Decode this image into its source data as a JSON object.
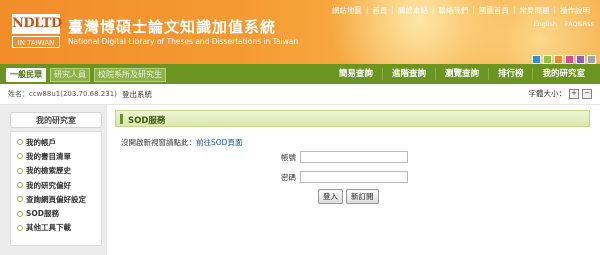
{
  "header": {
    "logo_text": "NDLTD",
    "logo_sub": "IN TAIWAN",
    "title": "臺灣博碩士論文知識加值系統",
    "subtitle": "National Digital Library of Theses and Dissertations in Taiwan",
    "top_links": [
      "網站地圖",
      "首頁",
      "關於本站",
      "聯絡我們",
      "國圖首頁",
      "常見問題",
      "操作說明"
    ],
    "languages": [
      "English",
      "FAQ&Rss"
    ],
    "theme_colors": [
      "#2f8fd6",
      "#8dc63f",
      "#f28c28",
      "#d84b8e",
      "#9b59b6",
      "#9aa7b3"
    ]
  },
  "roles": [
    "一般民眾",
    "研究人員",
    "校院系所及研究生"
  ],
  "main_nav": [
    "簡易查詢",
    "進階查詢",
    "瀏覽查詢",
    "排行榜",
    "我的研究室"
  ],
  "info": {
    "user": "姓名：ccw88u1(203.70.68.231)",
    "logout": "登出系統",
    "font_size_label": "字體大小：",
    "font_plus": "+",
    "font_minus": "−"
  },
  "sidebar": {
    "title": "我的研究室",
    "items": [
      "我的帳戶",
      "我的書目清單",
      "我的檢索歷史",
      "我的研究偏好",
      "查詢網頁偏好設定",
      "SOD服務",
      "其他工具下載"
    ]
  },
  "page": {
    "title": "SOD服務",
    "notice": "沒開啟新視窗請點此：",
    "notice_link": "前往SOD頁面",
    "account_label": "帳號",
    "account_value": "",
    "password_label": "密碼",
    "password_value": "",
    "login_button": "登入",
    "register_button": "新訂閱"
  },
  "colors": {
    "header_orange": "#f28d2a",
    "nav_green": "#6b9520",
    "accent_green": "#8fb04a"
  }
}
